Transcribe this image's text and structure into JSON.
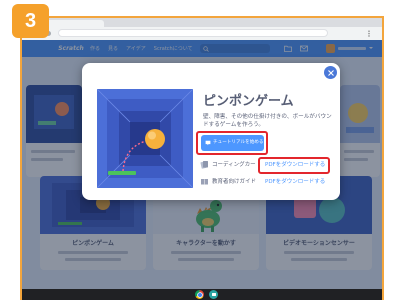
{
  "step_badge": "3",
  "colors": {
    "badge_orange": "#f5a12b",
    "scratch_blue": "#4d97ff",
    "highlight_red": "#e3262c",
    "text_gray": "#575e75"
  },
  "nav": {
    "logo": "Scratch",
    "items": [
      "作る",
      "見る",
      "アイデア",
      "Scratchについて"
    ],
    "icons": [
      "search-icon",
      "folder-icon",
      "mail-icon",
      "avatar"
    ]
  },
  "tutorial_cards": [
    {
      "title": "ピンポンゲーム"
    },
    {
      "title": "キャラクターを動かす"
    },
    {
      "title": "ビデオモーションセンサー"
    }
  ],
  "modal": {
    "title": "ピンポンゲーム",
    "description": "壁、障害、その他の仕掛け付きの、ボールがバウンドするゲームを作ろう。",
    "start_button": {
      "label": "チュートリアルを始める",
      "icon": "tutorial-icon",
      "highlighted": true
    },
    "resources": [
      {
        "label": "コーディングカー",
        "link": "PDFをダウンロードする",
        "icon": "coding-cards-icon",
        "link_highlighted": true
      },
      {
        "label": "教育者向けガイド",
        "link": "PDFをダウンロードする",
        "icon": "educator-guide-icon",
        "link_highlighted": false
      }
    ],
    "close_icon": "close-icon"
  },
  "taskbar": {
    "icons": [
      "chrome-icon",
      "files-icon"
    ]
  }
}
